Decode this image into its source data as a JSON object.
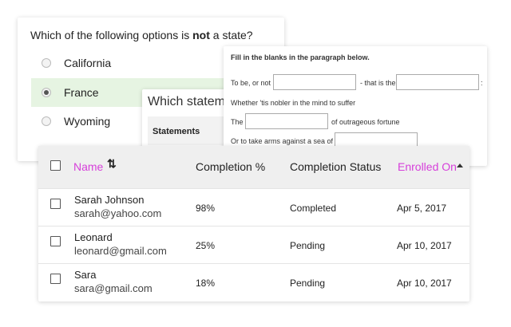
{
  "quiz": {
    "question_prefix": "Which of the following options is ",
    "question_bold": "not",
    "question_suffix": " a state?",
    "options": [
      {
        "label": "California",
        "selected": false
      },
      {
        "label": "France",
        "selected": true
      },
      {
        "label": "Wyoming",
        "selected": false
      }
    ]
  },
  "statements": {
    "title": "Which statem",
    "header": "Statements"
  },
  "blanks": {
    "title": "Fill in the blanks in the paragraph below.",
    "line1_a": "To be, or not",
    "line1_b": "- that is the",
    "line1_c": ":",
    "line2": "Whether 'tis nobler in the mind to suffer",
    "line3_a": "The",
    "line3_b": "of outrageous fortune",
    "line4": "Or to take arms against a sea of"
  },
  "table": {
    "columns": {
      "name": "Name",
      "completion": "Completion %",
      "status": "Completion Status",
      "enrolled": "Enrolled On"
    },
    "rows": [
      {
        "name": "Sarah Johnson",
        "email": "sarah@yahoo.com",
        "completion": "98%",
        "status": "Completed",
        "enrolled": "Apr 5, 2017"
      },
      {
        "name": "Leonard",
        "email": "leonard@gmail.com",
        "completion": "25%",
        "status": "Pending",
        "enrolled": "Apr 10, 2017"
      },
      {
        "name": "Sara",
        "email": "sara@gmail.com",
        "completion": "18%",
        "status": "Pending",
        "enrolled": "Apr 10, 2017"
      }
    ]
  },
  "colors": {
    "accent": "#d63fda",
    "selected_option_bg": "#e6f4e2",
    "table_header_bg": "#efefef"
  },
  "icons": {
    "sort": "sort-arrows-icon",
    "sorted_asc": "caret-up-icon"
  }
}
